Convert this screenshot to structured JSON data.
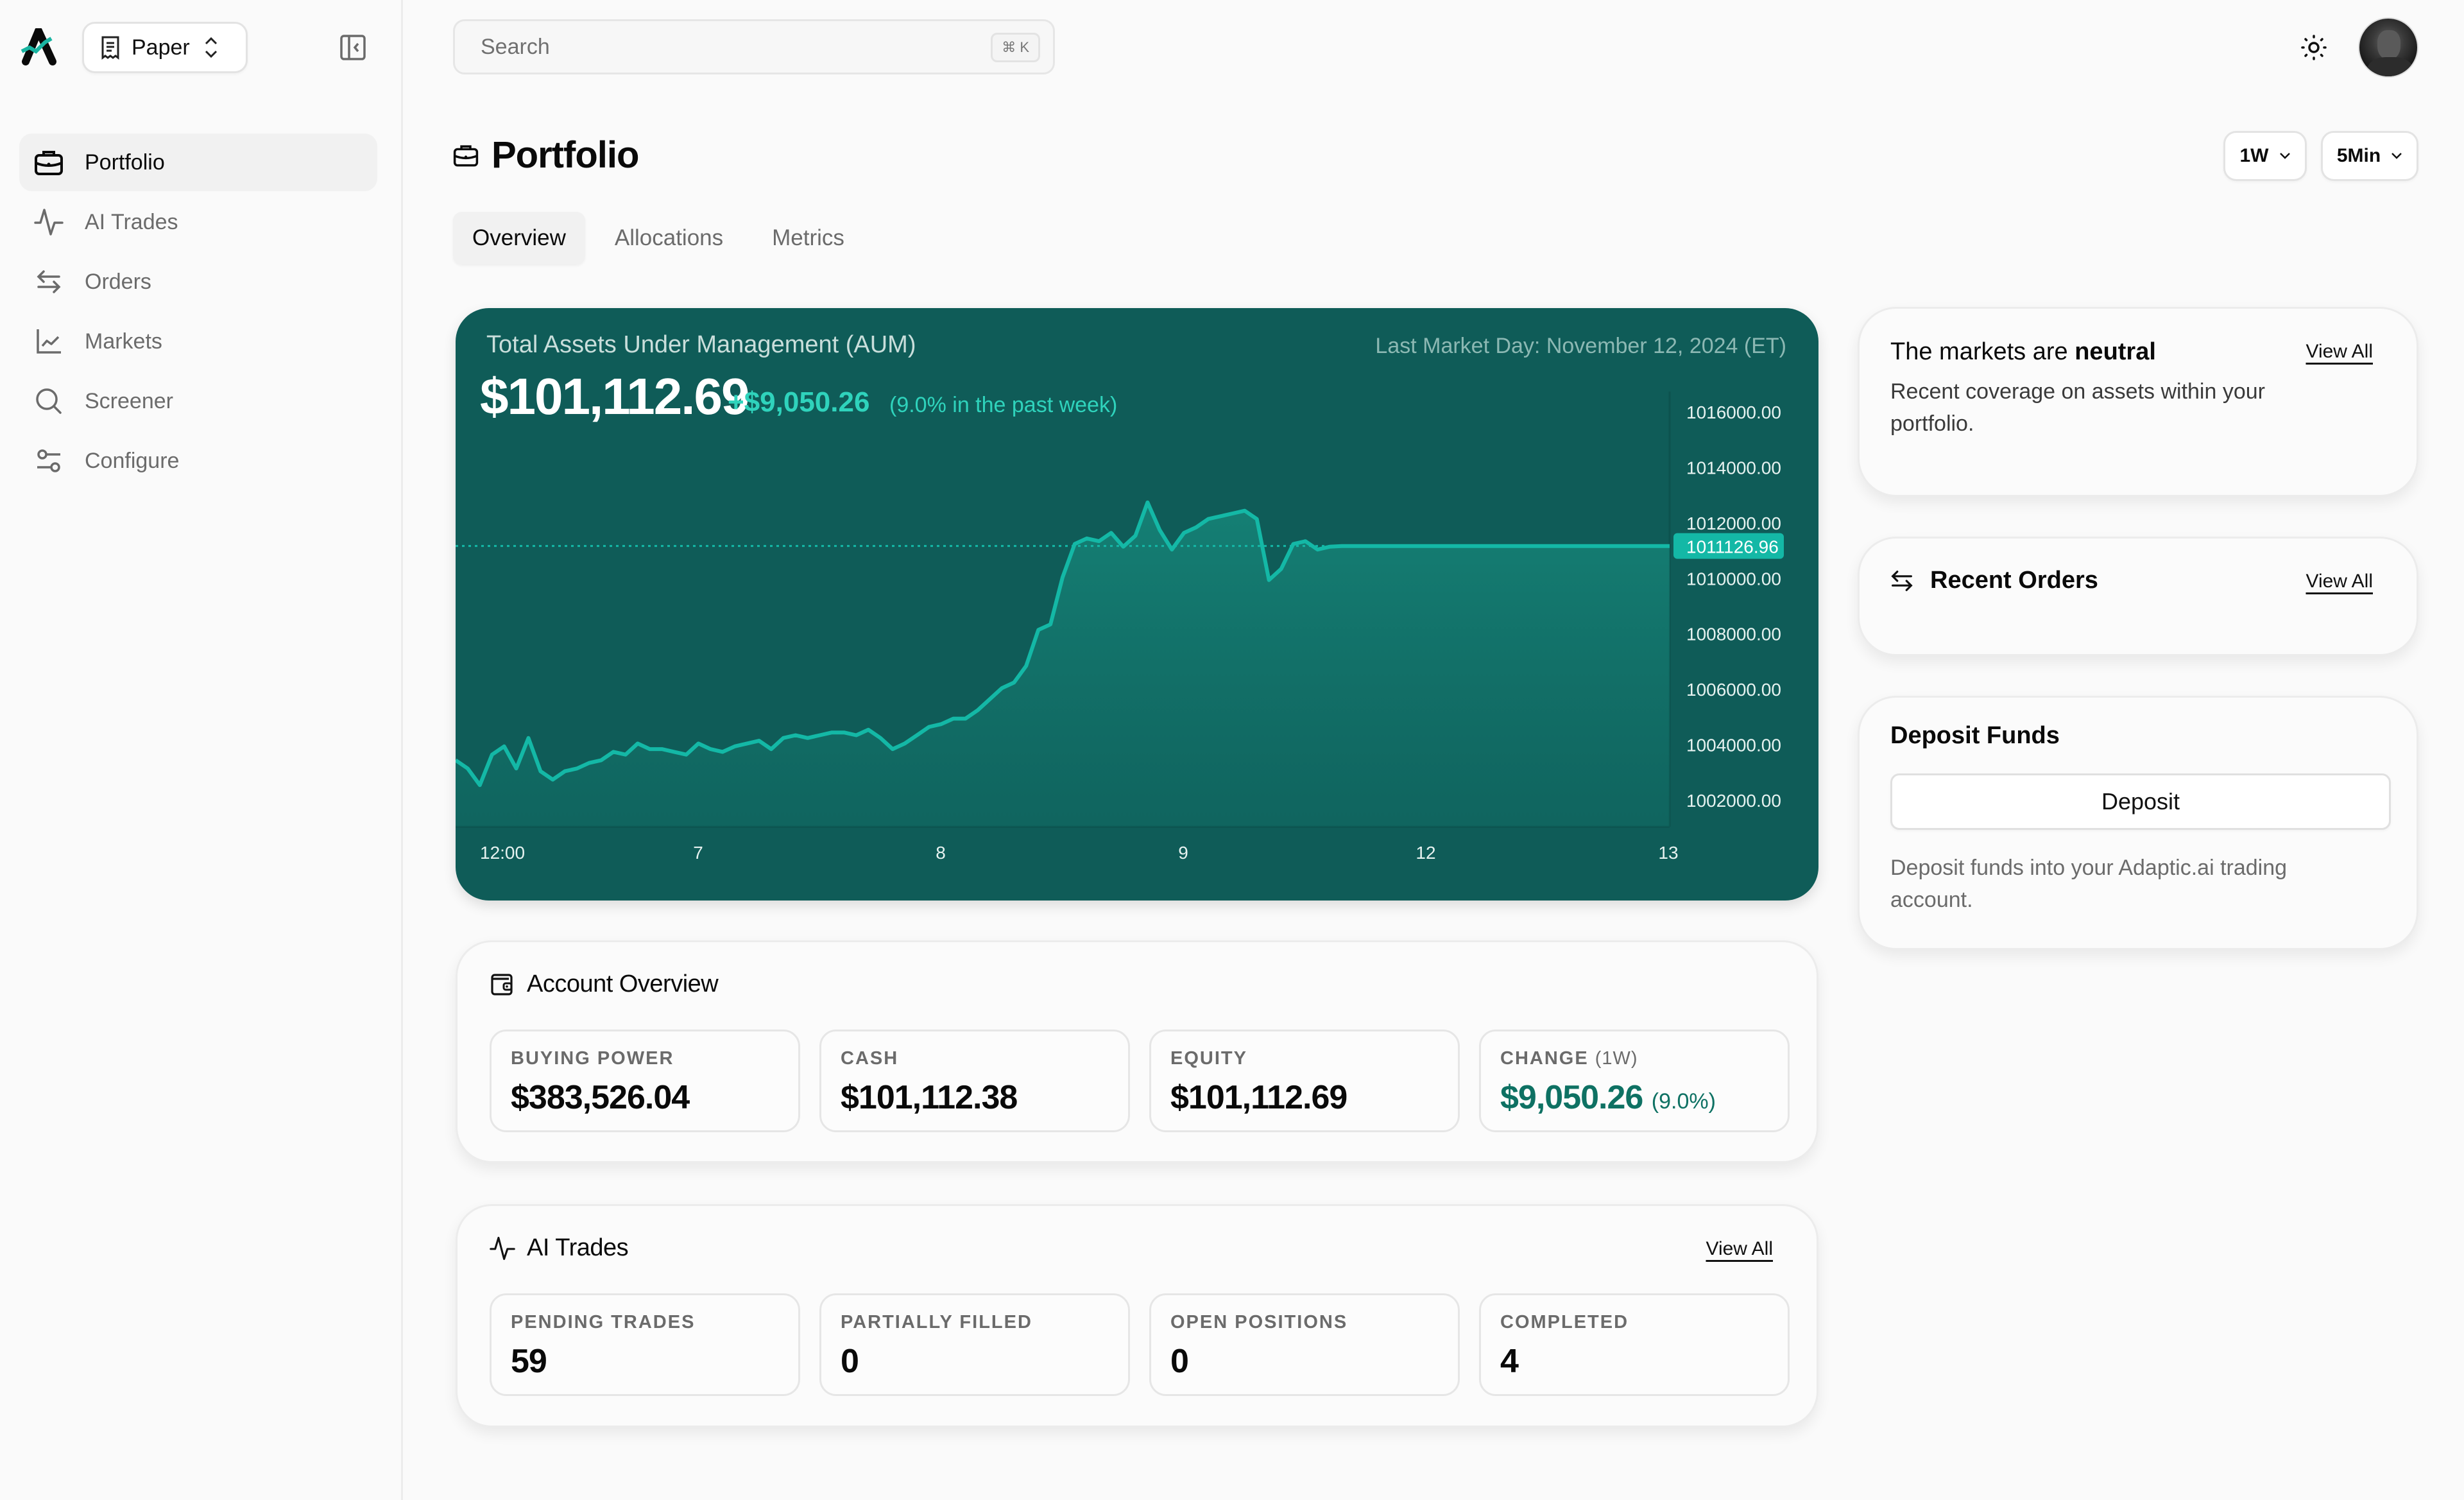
{
  "app": {
    "environment_label": "Paper",
    "colors": {
      "brand_teal": "#14b8a6",
      "chart_bg": "#0f5c58",
      "positive": "#2fd3bc",
      "positive_dark": "#0e7163"
    }
  },
  "sidebar": {
    "items": [
      {
        "label": "Portfolio",
        "icon": "briefcase-icon",
        "active": true
      },
      {
        "label": "AI Trades",
        "icon": "activity-icon",
        "active": false
      },
      {
        "label": "Orders",
        "icon": "arrows-left-right-icon",
        "active": false
      },
      {
        "label": "Markets",
        "icon": "line-chart-icon",
        "active": false
      },
      {
        "label": "Screener",
        "icon": "search-icon",
        "active": false
      },
      {
        "label": "Configure",
        "icon": "sliders-icon",
        "active": false
      }
    ]
  },
  "topbar": {
    "search_placeholder": "Search",
    "search_shortcut": "⌘ K"
  },
  "page": {
    "title": "Portfolio",
    "range": "1W",
    "interval": "5Min",
    "tabs": [
      {
        "label": "Overview",
        "active": true
      },
      {
        "label": "Allocations",
        "active": false
      },
      {
        "label": "Metrics",
        "active": false
      }
    ]
  },
  "aum": {
    "title": "Total Assets Under Management (AUM)",
    "last_market_day": "Last Market Day: November 12, 2024 (ET)",
    "value": "$101,112.69",
    "delta": "+$9,050.26",
    "delta_pct": "(9.0% in the past week)"
  },
  "chart_data": {
    "type": "area",
    "title": "Total Assets Under Management (AUM)",
    "xlabel": "",
    "ylabel": "",
    "x_tick_labels": [
      "12:00",
      "7",
      "8",
      "9",
      "12",
      "13"
    ],
    "y_tick_labels": [
      "1016000.00",
      "1014000.00",
      "1012000.00",
      "1010000.00",
      "1008000.00",
      "1006000.00",
      "1004000.00",
      "1002000.00"
    ],
    "y_ticks": [
      1016000,
      1014000,
      1012000,
      1010000,
      1008000,
      1006000,
      1004000,
      1002000
    ],
    "ylim": [
      1001000,
      1016700
    ],
    "current_price_label": "1011126.96",
    "current_price": 1011126.96,
    "grid": false,
    "series": [
      {
        "name": "AUM",
        "x": [
          0,
          1,
          2,
          3,
          4,
          5,
          6,
          7,
          8,
          9,
          10,
          11,
          12,
          13,
          14,
          15,
          16,
          17,
          18,
          19,
          20,
          21,
          22,
          23,
          24,
          25,
          26,
          27,
          28,
          29,
          30,
          31,
          32,
          33,
          34,
          35,
          36,
          37,
          38,
          39,
          40,
          41,
          42,
          43,
          44,
          45,
          46,
          47,
          48,
          49,
          50,
          51,
          52,
          53,
          54,
          55,
          56,
          57,
          58,
          59,
          60,
          61,
          62,
          63,
          64,
          65,
          66,
          67,
          68,
          69,
          70,
          71,
          72,
          73,
          74,
          75,
          76,
          77,
          78,
          79,
          80,
          81,
          82,
          83,
          84,
          85,
          86,
          87,
          88,
          89,
          90,
          91,
          92,
          93,
          94,
          95,
          96,
          97,
          98,
          99,
          100
        ],
        "values": [
          1003400,
          1003100,
          1002500,
          1003600,
          1003900,
          1003100,
          1004200,
          1003000,
          1002700,
          1003000,
          1003100,
          1003300,
          1003400,
          1003700,
          1003600,
          1004000,
          1003800,
          1003800,
          1003700,
          1003600,
          1004000,
          1003800,
          1003700,
          1003900,
          1004000,
          1004100,
          1003800,
          1004200,
          1004300,
          1004200,
          1004300,
          1004400,
          1004400,
          1004300,
          1004500,
          1004200,
          1003800,
          1004000,
          1004300,
          1004600,
          1004700,
          1004900,
          1004900,
          1005200,
          1005600,
          1006000,
          1006200,
          1006800,
          1008100,
          1008300,
          1010000,
          1011200,
          1011400,
          1011300,
          1011600,
          1011100,
          1011500,
          1012700,
          1011700,
          1011000,
          1011600,
          1011800,
          1012100,
          1012200,
          1012300,
          1012400,
          1012100,
          1009900,
          1010300,
          1011200,
          1011300,
          1011000,
          1011100,
          1011127,
          1011127,
          1011127,
          1011127,
          1011127,
          1011127,
          1011127,
          1011127,
          1011127,
          1011127,
          1011127,
          1011127,
          1011127,
          1011127,
          1011127,
          1011127,
          1011127,
          1011127,
          1011127,
          1011127,
          1011127,
          1011127,
          1011127,
          1011127,
          1011127,
          1011127,
          1011127,
          1011127
        ]
      }
    ]
  },
  "insights": {
    "title_prefix": "The markets are ",
    "title_emphasis": "neutral",
    "view_all": "View All",
    "description": "Recent coverage on assets within your portfolio."
  },
  "recent_orders": {
    "title": "Recent Orders",
    "view_all": "View All"
  },
  "deposit": {
    "title": "Deposit Funds",
    "button": "Deposit",
    "description": "Deposit funds into your Adaptic.ai trading account."
  },
  "account_overview": {
    "title": "Account Overview",
    "stats": [
      {
        "label": "BUYING POWER",
        "sub": "",
        "value": "$383,526.04",
        "pct": ""
      },
      {
        "label": "CASH",
        "sub": "",
        "value": "$101,112.38",
        "pct": ""
      },
      {
        "label": "EQUITY",
        "sub": "",
        "value": "$101,112.69",
        "pct": ""
      },
      {
        "label": "CHANGE ",
        "sub": "(1W)",
        "value": "$9,050.26 ",
        "pct": "(9.0%)"
      }
    ]
  },
  "ai_trades": {
    "title": "AI Trades",
    "view_all": "View All",
    "stats": [
      {
        "label": "PENDING TRADES",
        "value": "59"
      },
      {
        "label": "PARTIALLY FILLED",
        "value": "0"
      },
      {
        "label": "OPEN POSITIONS",
        "value": "0"
      },
      {
        "label": "COMPLETED",
        "value": "4"
      }
    ]
  }
}
